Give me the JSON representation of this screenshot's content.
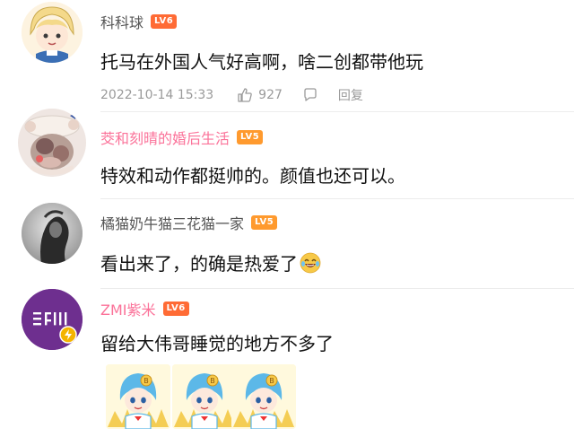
{
  "comments": [
    {
      "username": "科科球",
      "level": "LV6",
      "text": "托马在外国人气好高啊，啥二创都带他玩",
      "date": "2022-10-14 15:33",
      "likes": "927",
      "reply_label": "回复"
    },
    {
      "username": "茭和刻晴的婚后生活",
      "level": "LV5",
      "text": "特效和动作都挺帅的。颜值也还可以。"
    },
    {
      "username": "橘猫奶牛猫三花猫一家",
      "level": "LV5",
      "text": "看出来了，的确是热爱了"
    },
    {
      "username": "ZMI紫米",
      "level": "LV6",
      "text": "留给大伟哥睡觉的地方不多了",
      "avatar_logo": "ZMI"
    }
  ],
  "colors": {
    "username_gray": "#555555",
    "username_pink": "#fb7299",
    "lv6": "#ff6b35",
    "lv5": "#ff9a2e",
    "zmi_purple": "#6e2f8f",
    "meta_gray": "#9a9a9a"
  },
  "icons": [
    "thumbs-up-icon",
    "comment-icon",
    "laughing-crying-emoji",
    "bilibili-22-33-sticker"
  ]
}
